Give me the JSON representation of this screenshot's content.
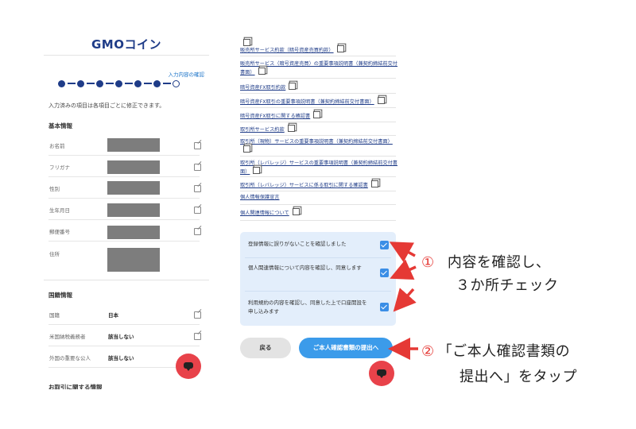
{
  "left": {
    "logo": "GMOコイン",
    "step_label": "入力内容の確認",
    "steps_total": 7,
    "steps_done": 6,
    "note": "入力済みの項目は各項目ごとに修正できます。",
    "basic_title": "基本情報",
    "basic_rows": [
      {
        "label": "お名前",
        "value": ""
      },
      {
        "label": "フリガナ",
        "value": ""
      },
      {
        "label": "性別",
        "value": ""
      },
      {
        "label": "生年月日",
        "value": ""
      },
      {
        "label": "郵便番号",
        "value": ""
      },
      {
        "label": "住所",
        "value": ""
      }
    ],
    "nation_title": "国籍情報",
    "nation_rows": [
      {
        "label": "国籍",
        "value": "日本"
      },
      {
        "label": "米国納税義務者",
        "value": "該当しない"
      },
      {
        "label": "外国の重要な公人",
        "value": "該当しない"
      }
    ],
    "bottom_cut": "お取引に関する情報"
  },
  "right": {
    "links": [
      "販売所サービス約款（暗号資産売買約款）",
      "販売所サービス（暗号資産売買）の重要事項説明書（兼契約締結前交付書面）",
      "暗号資産FX取引約款",
      "暗号資産FX取引の重要事項説明書（兼契約締結前交付書面）",
      "暗号資産FX取引に関する確認書",
      "取引所サービス約款",
      "取引所（現物）サービスの重要事項説明書（兼契約締結前交付書面）",
      "取引所（レバレッジ）サービスの重要事項説明書（兼契約締結前交付書面）",
      "取引所（レバレッジ）サービスに係る取引に関する確認書",
      "個人情報保護宣言",
      "個人関連情報について"
    ],
    "checks": [
      "登録情報に誤りがないことを確認しました",
      "個人関連情報について内容を確認し、同意します",
      "利用規約の内容を確認し、同意した上で口座開設を申し込みます"
    ],
    "back_label": "戻る",
    "submit_label": "ご本人確認書類の提出へ"
  },
  "annotations": {
    "a1_num": "①",
    "a1_line1": "内容を確認し、",
    "a1_line2": "３か所チェック",
    "a2_num": "②",
    "a2_line1": "「ご本人確認書類の",
    "a2_line2": "提出へ」をタップ"
  },
  "colors": {
    "brand": "#1f3c88",
    "accent": "#3b9bea",
    "arrow": "#e53935",
    "chat": "#e8424a"
  }
}
